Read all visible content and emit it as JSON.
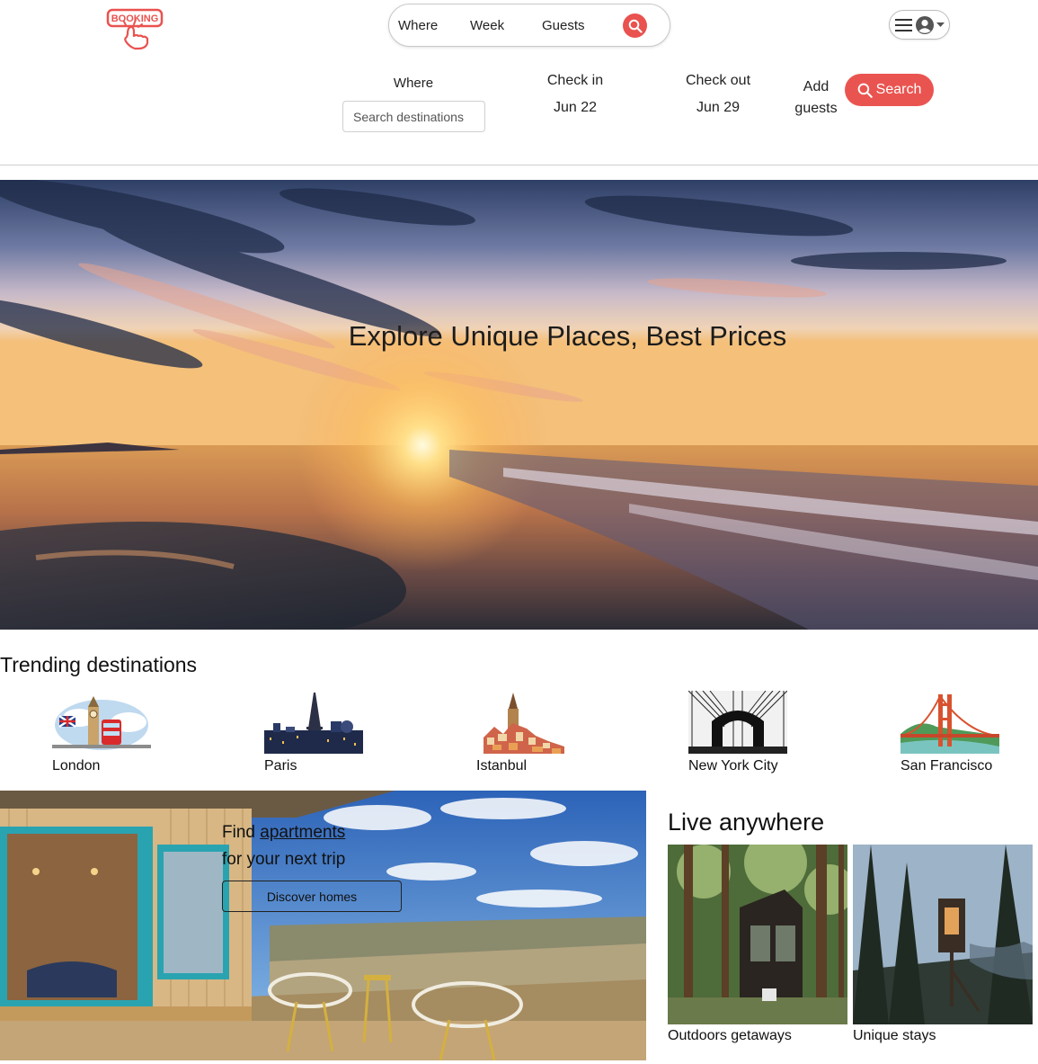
{
  "logo": {
    "text": "BOOKING",
    "brand_color": "#e9524f"
  },
  "compact_search": {
    "where": "Where",
    "week": "Week",
    "guests": "Guests",
    "icon": "search-icon"
  },
  "user_menu": {
    "icons": [
      "menu-icon",
      "user-avatar-icon",
      "caret-down-icon"
    ]
  },
  "search_form": {
    "where_label": "Where",
    "where_placeholder": "Search destinations",
    "checkin_label": "Check in",
    "checkin_value": "Jun 22",
    "checkout_label": "Check out",
    "checkout_value": "Jun 29",
    "guests_label_line1": "Add",
    "guests_label_line2": "guests",
    "search_button": "Search"
  },
  "hero": {
    "title": "Explore Unique Places, Best Prices"
  },
  "trending": {
    "title": "Trending destinations",
    "items": [
      {
        "name": "London"
      },
      {
        "name": "Paris"
      },
      {
        "name": "Istanbul"
      },
      {
        "name": "New York City"
      },
      {
        "name": "San Francisco"
      }
    ]
  },
  "promo": {
    "line1_prefix": "Find ",
    "line1_link": "apartments",
    "line2": "for your next trip",
    "button": "Discover homes"
  },
  "live": {
    "title": "Live anywhere",
    "cards": [
      {
        "caption": "Outdoors getaways"
      },
      {
        "caption": "Unique stays"
      }
    ]
  }
}
